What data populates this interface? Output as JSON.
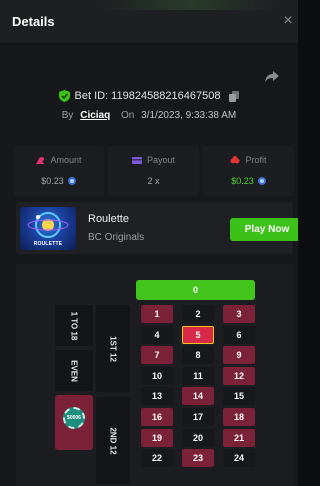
{
  "header": {
    "title": "Details",
    "close_symbol": "×"
  },
  "bet": {
    "id_label": "Bet ID: 119824588216467508",
    "by_label": "By",
    "username": "Ciciaq",
    "on_label": "On",
    "datetime": "3/1/2023, 9:33:38 AM"
  },
  "stats": [
    {
      "label": "Amount",
      "value": "$0.23",
      "icon": "amount-icon",
      "color": "#e0326b"
    },
    {
      "label": "Payout",
      "value": "2 x",
      "icon": "payout-icon",
      "color": "#7b5cd6"
    },
    {
      "label": "Profit",
      "value": "$0.23",
      "icon": "profit-icon",
      "color": "#e23434"
    }
  ],
  "game": {
    "name": "Roulette",
    "provider": "BC Originals",
    "thumb_label": "ROULETTE",
    "play_label": "Play Now"
  },
  "board": {
    "zero": "0",
    "side_labels": {
      "low": "1 TO 18",
      "even": "EVEN",
      "dozen1": "1ST 12",
      "dozen2": "2ND 12"
    },
    "chip_label": "$0006",
    "highlighted_number": "5",
    "numbers": [
      [
        "1",
        "2",
        "3"
      ],
      [
        "4",
        "5",
        "6"
      ],
      [
        "7",
        "8",
        "9"
      ],
      [
        "10",
        "11",
        "12"
      ],
      [
        "13",
        "14",
        "15"
      ],
      [
        "16",
        "17",
        "18"
      ],
      [
        "19",
        "20",
        "21"
      ],
      [
        "22",
        "23",
        "24"
      ]
    ],
    "red_numbers": [
      "1",
      "3",
      "5",
      "7",
      "9",
      "12",
      "14",
      "16",
      "18",
      "19",
      "21",
      "23"
    ]
  },
  "colors": {
    "accent_green": "#3bc117",
    "red_cell": "#7b2238",
    "black_cell": "#17181b"
  }
}
